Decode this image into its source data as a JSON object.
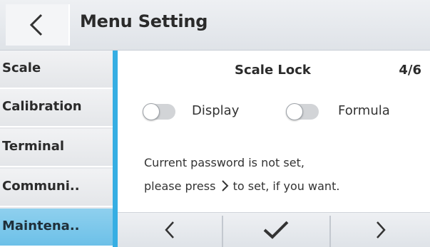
{
  "header": {
    "title": "Menu Setting",
    "back_icon": "chevron-left-icon"
  },
  "sidebar": {
    "items": [
      {
        "label": "Scale",
        "active": false
      },
      {
        "label": "Calibration",
        "active": false
      },
      {
        "label": "Terminal",
        "active": false
      },
      {
        "label": "Communi..",
        "active": false
      },
      {
        "label": "Maintena..",
        "active": true
      }
    ]
  },
  "content": {
    "title": "Scale Lock",
    "page": "4/6",
    "toggles": [
      {
        "label": "Display",
        "on": false
      },
      {
        "label": "Formula",
        "on": false
      }
    ],
    "message_line1": "Current password is not set,",
    "message_line2_before": "please press",
    "message_line2_after": "to set, if you want."
  },
  "nav": {
    "icons": [
      "chevron-left-icon",
      "check-icon",
      "chevron-right-icon"
    ]
  },
  "colors": {
    "accent": "#36aee3",
    "active_item": "#7ac7eb"
  }
}
